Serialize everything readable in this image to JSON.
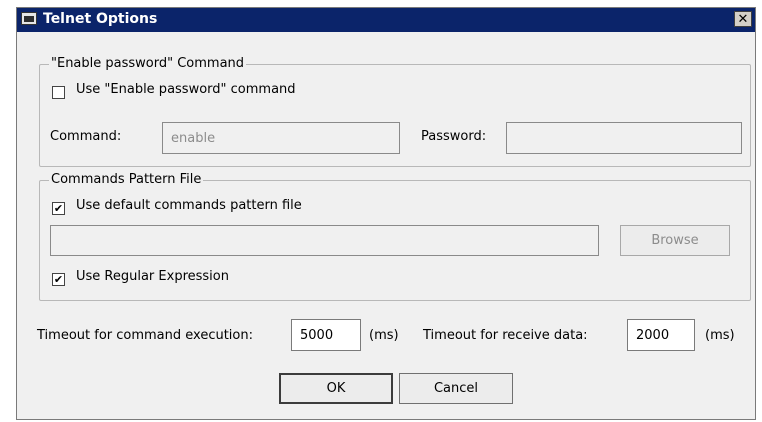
{
  "window": {
    "title": "Telnet Options",
    "close_glyph": "✕"
  },
  "enable_group": {
    "legend": "\"Enable password\" Command",
    "checkbox_label": "Use \"Enable password\" command",
    "checked": false,
    "command_label": "Command:",
    "command_value": "enable",
    "password_label": "Password:",
    "password_value": ""
  },
  "pattern_group": {
    "legend": "Commands Pattern File",
    "default_checkbox_label": "Use default commands pattern file",
    "default_checked": true,
    "file_path_value": "",
    "browse_label": "Browse",
    "regex_checkbox_label": "Use Regular Expression",
    "regex_checked": true
  },
  "timeouts": {
    "command_label": "Timeout for command execution:",
    "command_value": "5000",
    "command_unit": "(ms)",
    "receive_label": "Timeout for receive data:",
    "receive_value": "2000",
    "receive_unit": "(ms)"
  },
  "buttons": {
    "ok": "OK",
    "cancel": "Cancel"
  },
  "check_glyph": "✔"
}
